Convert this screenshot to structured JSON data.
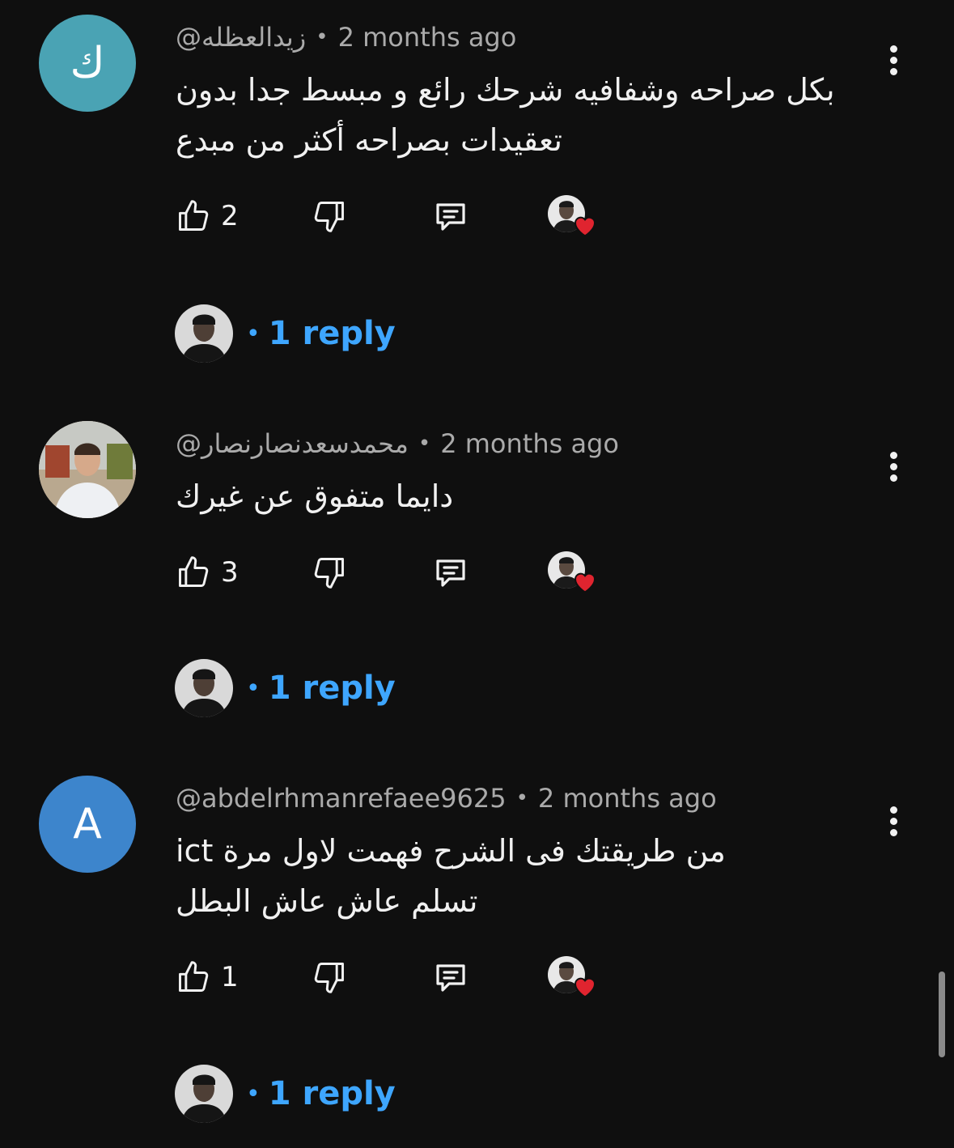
{
  "comments": [
    {
      "avatar_letter": "ك",
      "avatar_color": "#4aa3b4",
      "author": "@زيدالعظله",
      "time": "2 months ago",
      "lines": [
        "بكل صراحه وشفافيه شرحك رائع و مبسط جدا بدون",
        "تعقيدات بصراحه أكثر من مبدع"
      ],
      "likes": "2",
      "replies_label": "1 reply"
    },
    {
      "avatar_letter": "",
      "avatar_color": "#c9c2b6",
      "author": "@محمدسعدنصارنصار",
      "time": "2 months ago",
      "lines": [
        "دايما متفوق عن غيرك"
      ],
      "likes": "3",
      "replies_label": "1 reply"
    },
    {
      "avatar_letter": "A",
      "avatar_color": "#3d85cc",
      "author": "@abdelrhmanrefaee9625",
      "time": "2 months ago",
      "lines": [
        "من طريقتك فى الشرح فهمت لاول مرة ict",
        "تسلم عاش عاش البطل"
      ],
      "likes": "1",
      "replies_label": "1 reply"
    }
  ],
  "separator": "•",
  "colors": {
    "background": "#0f0f0f",
    "text": "#f1f1f1",
    "meta": "#aaaaaa",
    "link_blue": "#3ea6ff",
    "heart_red": "#e0242f"
  },
  "icons": [
    "thumbs-up-icon",
    "thumbs-down-icon",
    "reply-comment-icon",
    "creator-heart-icon",
    "more-vertical-icon"
  ]
}
